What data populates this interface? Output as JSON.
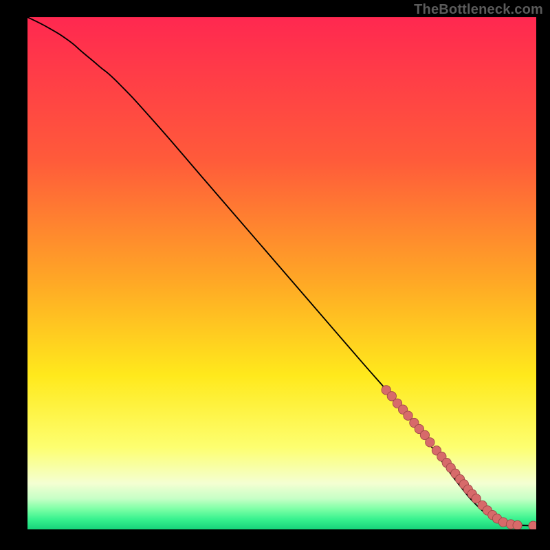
{
  "attribution": "TheBottleneck.com",
  "colors": {
    "frame": "#000000",
    "curve": "#000000",
    "point_fill": "#d76a6a",
    "point_stroke": "#9f4848",
    "gradient_stops": [
      {
        "offset": 0,
        "color": "#ff2850"
      },
      {
        "offset": 28,
        "color": "#ff5b3a"
      },
      {
        "offset": 52,
        "color": "#ffa925"
      },
      {
        "offset": 70,
        "color": "#ffe91c"
      },
      {
        "offset": 84,
        "color": "#fdff70"
      },
      {
        "offset": 91,
        "color": "#f4ffd2"
      },
      {
        "offset": 94,
        "color": "#c6ffc6"
      },
      {
        "offset": 96,
        "color": "#7effa6"
      },
      {
        "offset": 98,
        "color": "#38f28f"
      },
      {
        "offset": 100,
        "color": "#17d37a"
      }
    ]
  },
  "chart_data": {
    "type": "line",
    "title": "",
    "xlabel": "",
    "ylabel": "",
    "xlim": [
      0,
      100
    ],
    "ylim": [
      0,
      100
    ],
    "series": [
      {
        "name": "curve",
        "x": [
          0,
          4,
          8,
          11,
          14,
          18,
          25,
          35,
          45,
          55,
          65,
          72,
          78,
          82,
          85,
          88,
          91,
          94,
          97,
          100
        ],
        "y": [
          100,
          98,
          95.5,
          93,
          90.5,
          87,
          79.5,
          68,
          56.5,
          45,
          33.5,
          25.5,
          18,
          12.5,
          8.5,
          5,
          2.5,
          1,
          0.8,
          0.7
        ]
      }
    ],
    "points": {
      "name": "cluster",
      "x": [
        70.5,
        71.6,
        72.7,
        73.8,
        74.8,
        76.0,
        77.0,
        78.1,
        79.1,
        80.4,
        81.4,
        82.4,
        83.2,
        84.1,
        85.0,
        85.8,
        86.6,
        87.4,
        88.2,
        89.4,
        90.4,
        91.4,
        92.3,
        93.5,
        95.0,
        96.3,
        99.4
      ],
      "y": [
        27.2,
        26.0,
        24.6,
        23.4,
        22.2,
        20.8,
        19.6,
        18.4,
        17.0,
        15.4,
        14.2,
        13.0,
        12.0,
        10.9,
        9.8,
        8.8,
        7.8,
        6.9,
        6.0,
        4.7,
        3.7,
        2.8,
        2.1,
        1.4,
        1.0,
        0.8,
        0.7
      ]
    }
  }
}
